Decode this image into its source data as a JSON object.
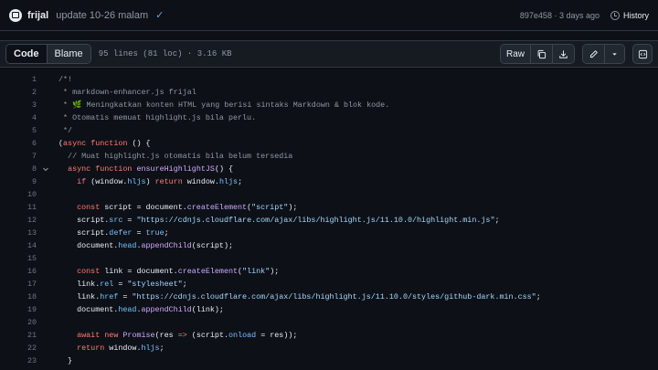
{
  "commit": {
    "author": "frijal",
    "message": "update 10-26 malam",
    "check": "✓",
    "sha": "897e458",
    "time": "3 days ago",
    "meta": "897e458 · 3 days ago",
    "history_label": "History"
  },
  "file_header": {
    "tabs": [
      "Code",
      "Blame"
    ],
    "active_tab": "Code",
    "info": "95 lines (81 loc) · 3.16 KB",
    "raw_label": "Raw"
  },
  "code": {
    "lines": [
      {
        "n": "1",
        "tokens": [
          [
            "c-com",
            "/*!"
          ]
        ]
      },
      {
        "n": "2",
        "tokens": [
          [
            "c-com",
            " * markdown-enhancer.js frijal"
          ]
        ]
      },
      {
        "n": "3",
        "tokens": [
          [
            "c-com",
            " * 🌿 Meningkatkan konten HTML yang berisi sintaks Markdown & blok kode."
          ]
        ]
      },
      {
        "n": "4",
        "tokens": [
          [
            "c-com",
            " * Otomatis memuat highlight.js bila perlu."
          ]
        ]
      },
      {
        "n": "5",
        "tokens": [
          [
            "c-com",
            " */"
          ]
        ]
      },
      {
        "n": "6",
        "tokens": [
          [
            "c-plain",
            "("
          ],
          [
            "c-kw",
            "async"
          ],
          [
            "c-plain",
            " "
          ],
          [
            "c-kw",
            "function"
          ],
          [
            "c-plain",
            " () {"
          ]
        ]
      },
      {
        "n": "7",
        "tokens": [
          [
            "c-com",
            "  // Muat highlight.js otomatis bila belum tersedia"
          ]
        ]
      },
      {
        "n": "8",
        "fold": true,
        "tokens": [
          [
            "c-plain",
            "  "
          ],
          [
            "c-kw",
            "async"
          ],
          [
            "c-plain",
            " "
          ],
          [
            "c-kw",
            "function"
          ],
          [
            "c-plain",
            " "
          ],
          [
            "c-fn",
            "ensureHighlightJS"
          ],
          [
            "c-plain",
            "() {"
          ]
        ]
      },
      {
        "n": "9",
        "tokens": [
          [
            "c-plain",
            "    "
          ],
          [
            "c-kw",
            "if"
          ],
          [
            "c-plain",
            " (window."
          ],
          [
            "c-prop",
            "hljs"
          ],
          [
            "c-plain",
            ") "
          ],
          [
            "c-kw",
            "return"
          ],
          [
            "c-plain",
            " window."
          ],
          [
            "c-prop",
            "hljs"
          ],
          [
            "c-plain",
            ";"
          ]
        ]
      },
      {
        "n": "10",
        "tokens": []
      },
      {
        "n": "11",
        "tokens": [
          [
            "c-plain",
            "    "
          ],
          [
            "c-kw",
            "const"
          ],
          [
            "c-plain",
            " script = document."
          ],
          [
            "c-fn",
            "createElement"
          ],
          [
            "c-plain",
            "("
          ],
          [
            "c-str",
            "\"script\""
          ],
          [
            "c-plain",
            ");"
          ]
        ]
      },
      {
        "n": "12",
        "tokens": [
          [
            "c-plain",
            "    script."
          ],
          [
            "c-prop",
            "src"
          ],
          [
            "c-plain",
            " = "
          ],
          [
            "c-str",
            "\"https://cdnjs.cloudflare.com/ajax/libs/highlight.js/11.10.0/highlight.min.js\""
          ],
          [
            "c-plain",
            ";"
          ]
        ]
      },
      {
        "n": "13",
        "tokens": [
          [
            "c-plain",
            "    script."
          ],
          [
            "c-prop",
            "defer"
          ],
          [
            "c-plain",
            " = "
          ],
          [
            "c-prop",
            "true"
          ],
          [
            "c-plain",
            ";"
          ]
        ]
      },
      {
        "n": "14",
        "tokens": [
          [
            "c-plain",
            "    document."
          ],
          [
            "c-prop",
            "head"
          ],
          [
            "c-plain",
            "."
          ],
          [
            "c-fn",
            "appendChild"
          ],
          [
            "c-plain",
            "(script);"
          ]
        ]
      },
      {
        "n": "15",
        "tokens": []
      },
      {
        "n": "16",
        "tokens": [
          [
            "c-plain",
            "    "
          ],
          [
            "c-kw",
            "const"
          ],
          [
            "c-plain",
            " link = document."
          ],
          [
            "c-fn",
            "createElement"
          ],
          [
            "c-plain",
            "("
          ],
          [
            "c-str",
            "\"link\""
          ],
          [
            "c-plain",
            ");"
          ]
        ]
      },
      {
        "n": "17",
        "tokens": [
          [
            "c-plain",
            "    link."
          ],
          [
            "c-prop",
            "rel"
          ],
          [
            "c-plain",
            " = "
          ],
          [
            "c-str",
            "\"stylesheet\""
          ],
          [
            "c-plain",
            ";"
          ]
        ]
      },
      {
        "n": "18",
        "tokens": [
          [
            "c-plain",
            "    link."
          ],
          [
            "c-prop",
            "href"
          ],
          [
            "c-plain",
            " = "
          ],
          [
            "c-str",
            "\"https://cdnjs.cloudflare.com/ajax/libs/highlight.js/11.10.0/styles/github-dark.min.css\""
          ],
          [
            "c-plain",
            ";"
          ]
        ]
      },
      {
        "n": "19",
        "tokens": [
          [
            "c-plain",
            "    document."
          ],
          [
            "c-prop",
            "head"
          ],
          [
            "c-plain",
            "."
          ],
          [
            "c-fn",
            "appendChild"
          ],
          [
            "c-plain",
            "(link);"
          ]
        ]
      },
      {
        "n": "20",
        "tokens": []
      },
      {
        "n": "21",
        "tokens": [
          [
            "c-plain",
            "    "
          ],
          [
            "c-kw",
            "await"
          ],
          [
            "c-plain",
            " "
          ],
          [
            "c-kw",
            "new"
          ],
          [
            "c-plain",
            " "
          ],
          [
            "c-fn",
            "Promise"
          ],
          [
            "c-plain",
            "(res "
          ],
          [
            "c-kw",
            "=>"
          ],
          [
            "c-plain",
            " (script."
          ],
          [
            "c-prop",
            "onload"
          ],
          [
            "c-plain",
            " = res));"
          ]
        ]
      },
      {
        "n": "22",
        "tokens": [
          [
            "c-plain",
            "    "
          ],
          [
            "c-kw",
            "return"
          ],
          [
            "c-plain",
            " window."
          ],
          [
            "c-prop",
            "hljs"
          ],
          [
            "c-plain",
            ";"
          ]
        ]
      },
      {
        "n": "23",
        "tokens": [
          [
            "c-plain",
            "  }"
          ]
        ]
      }
    ]
  },
  "colors": {
    "background": "#0d1117",
    "header_bg": "#161b22",
    "comment": "#9198a1",
    "keyword": "#ff7b72",
    "function": "#d2a8ff",
    "string": "#a5d6ff",
    "property": "#79c0ff"
  },
  "icons": [
    "repo-avatar-icon",
    "check-icon",
    "history-icon",
    "copy-icon",
    "download-icon",
    "pencil-icon",
    "chevron-down-icon",
    "symbols-icon",
    "fold-chevron-icon"
  ]
}
